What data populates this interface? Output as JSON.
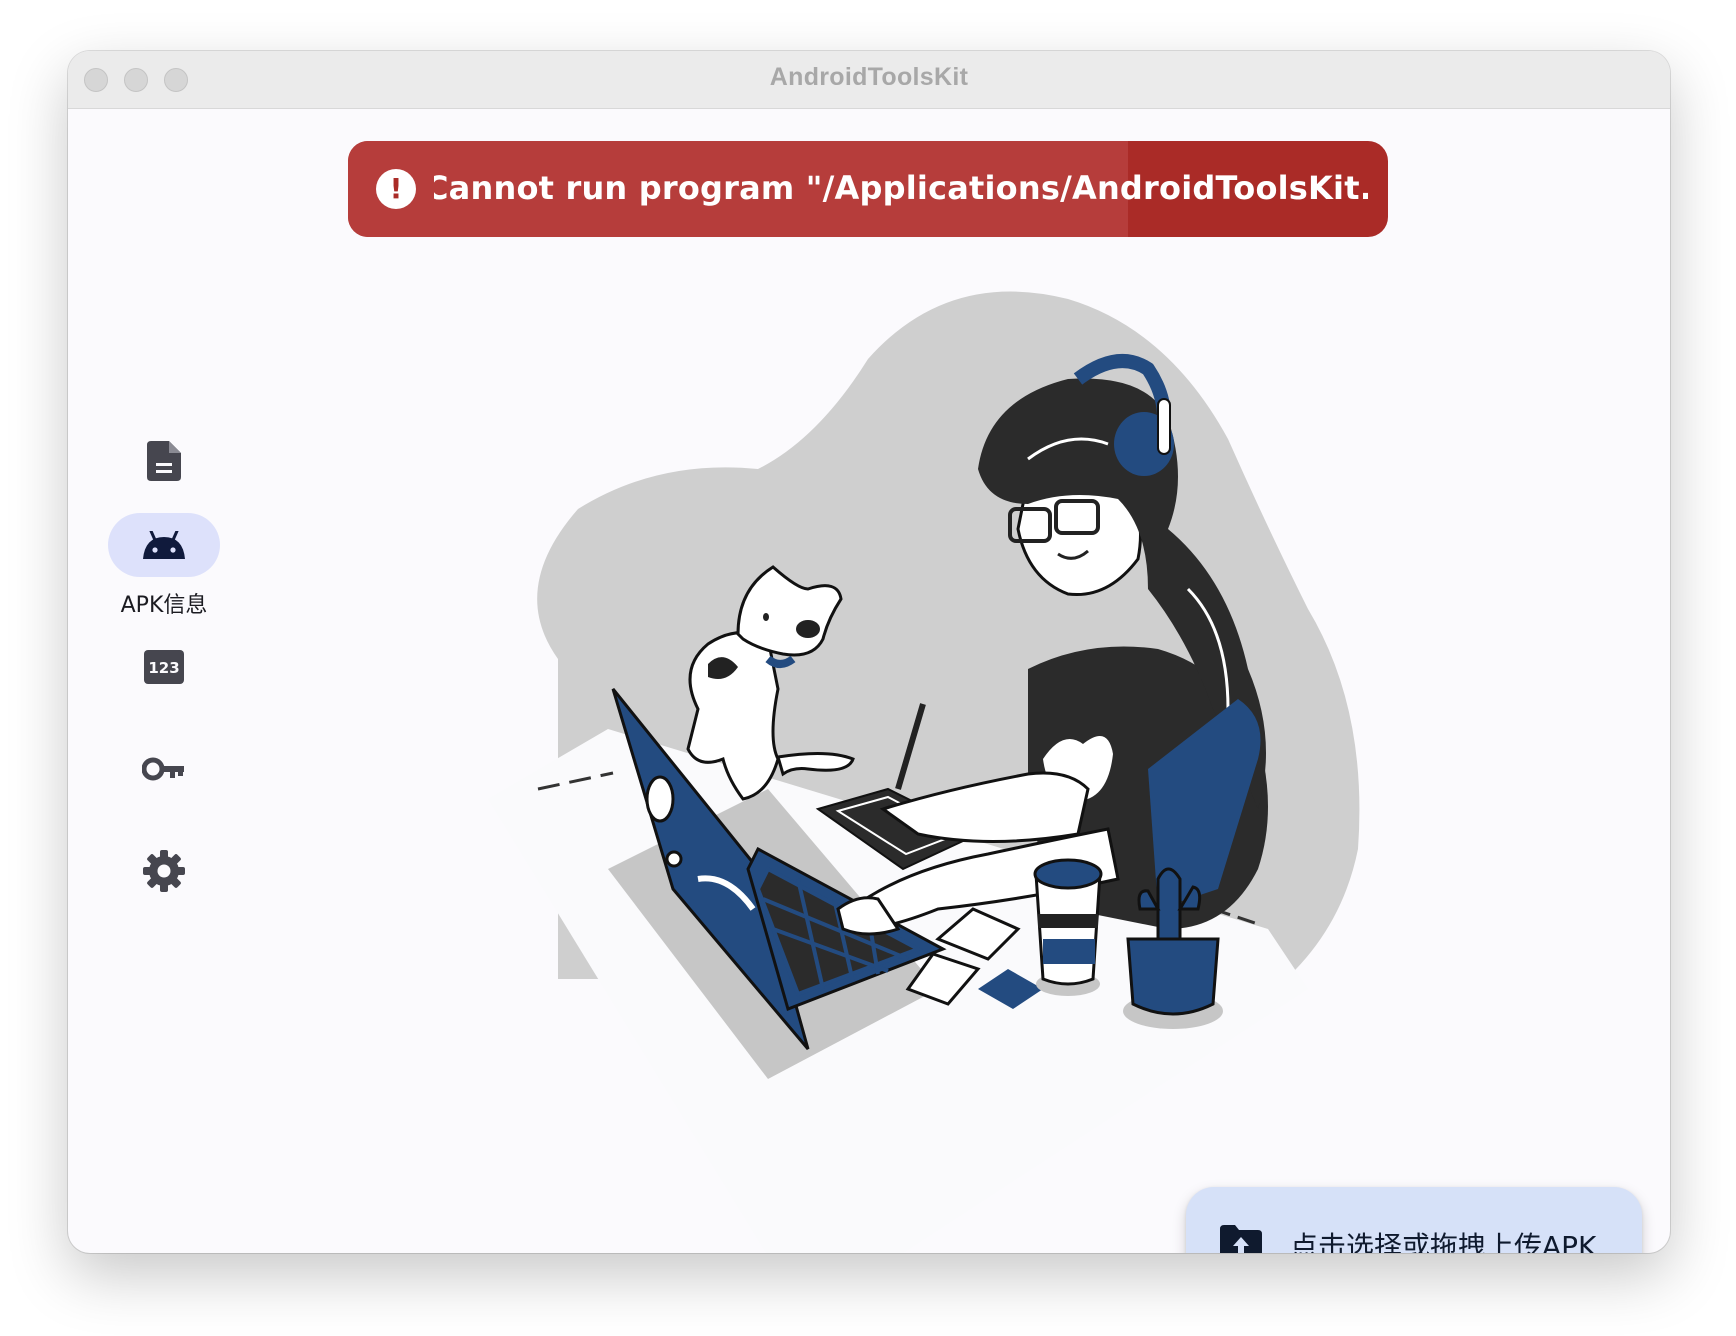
{
  "window": {
    "title": "AndroidToolsKit"
  },
  "snackbar": {
    "type": "error",
    "icon": "exclamation-circle-icon",
    "message": "Cannot run program \"/Applications/AndroidToolsKit.app/",
    "progress": 0.75,
    "colors": {
      "background": "#aa2b27",
      "progress": "#b63d3b",
      "text": "#ffffff"
    }
  },
  "sidebar": {
    "items": [
      {
        "id": "document",
        "icon": "document-icon",
        "label": "",
        "active": false
      },
      {
        "id": "apk-info",
        "icon": "android-icon",
        "label": "APK信息",
        "active": true
      },
      {
        "id": "number",
        "icon": "123-icon",
        "label": "",
        "active": false
      },
      {
        "id": "key",
        "icon": "key-icon",
        "label": "",
        "active": false
      },
      {
        "id": "settings",
        "icon": "gear-icon",
        "label": "",
        "active": false
      }
    ],
    "active_color": "#dde1fb"
  },
  "illustration": {
    "subject": "woman-working-at-laptop-with-cat",
    "accent_color": "#234b80"
  },
  "upload_button": {
    "icon": "folder-upload-icon",
    "label": "点击选择或拖拽上传APK",
    "background": "#d6e1f8"
  }
}
